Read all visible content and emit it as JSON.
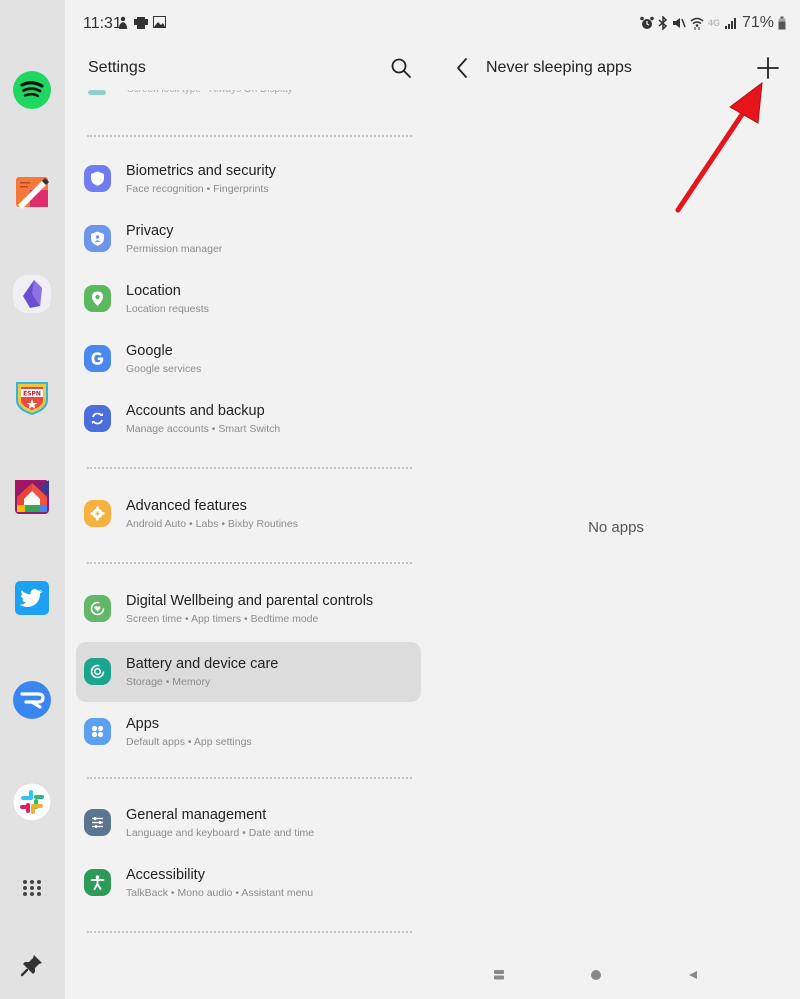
{
  "status_bar": {
    "time": "11:31",
    "notification_icons": [
      "accessibility-helper-icon",
      "phone-cast-icon",
      "gallery-icon"
    ],
    "system_icons": [
      "alarm-icon",
      "bluetooth-icon",
      "mute-icon",
      "wifi-icon",
      "4g-icon",
      "signal-icon"
    ],
    "network_label": "4G",
    "battery_percent": "71%"
  },
  "taskbar": {
    "apps": [
      {
        "name": "spotify",
        "color": "#1ed760"
      },
      {
        "name": "notes",
        "color": "#f26b3a"
      },
      {
        "name": "obsidian",
        "color": "#7c5fd6"
      },
      {
        "name": "espn-fantasy",
        "color": "#2aa0d8"
      },
      {
        "name": "google-home",
        "color": "#ea4335"
      },
      {
        "name": "twitter",
        "color": "#1da1f2"
      },
      {
        "name": "relay",
        "color": "#3d8bf2"
      },
      {
        "name": "slack",
        "color": "#ffffff"
      }
    ],
    "all_apps_icon": "grid-icon",
    "pin_icon": "pin-icon"
  },
  "settings": {
    "title": "Settings",
    "partial_item_subtitle": "Screen lock type  •  Always On Display",
    "groups": [
      {
        "items": [
          {
            "label": "Biometrics and security",
            "subtitle": "Face recognition  •  Fingerprints",
            "icon": "shield-icon",
            "color": "#6f7df0"
          },
          {
            "label": "Privacy",
            "subtitle": "Permission manager",
            "icon": "privacy-shield-icon",
            "color": "#6d95ec"
          },
          {
            "label": "Location",
            "subtitle": "Location requests",
            "icon": "location-pin-icon",
            "color": "#5cb85c"
          },
          {
            "label": "Google",
            "subtitle": "Google services",
            "icon": "google-icon",
            "color": "#4a87ee"
          },
          {
            "label": "Accounts and backup",
            "subtitle": "Manage accounts  •  Smart Switch",
            "icon": "sync-icon",
            "color": "#4a6fdc"
          }
        ]
      },
      {
        "items": [
          {
            "label": "Advanced features",
            "subtitle": "Android Auto  •  Labs  •  Bixby Routines",
            "icon": "gear-plus-icon",
            "color": "#f6b13f"
          }
        ]
      },
      {
        "items": [
          {
            "label": "Digital Wellbeing and parental controls",
            "subtitle": "Screen time  •  App timers  •  Bedtime mode",
            "icon": "wellbeing-icon",
            "color": "#62b768"
          },
          {
            "label": "Battery and device care",
            "subtitle": "Storage  •  Memory",
            "icon": "device-care-icon",
            "color": "#1aa58f",
            "active": true
          },
          {
            "label": "Apps",
            "subtitle": "Default apps  •  App settings",
            "icon": "apps-grid-icon",
            "color": "#5d9ff0"
          }
        ]
      },
      {
        "items": [
          {
            "label": "General management",
            "subtitle": "Language and keyboard  •  Date and time",
            "icon": "sliders-icon",
            "color": "#5b7591"
          },
          {
            "label": "Accessibility",
            "subtitle": "TalkBack  •  Mono audio  •  Assistant menu",
            "icon": "accessibility-icon",
            "color": "#2e9a58"
          }
        ]
      }
    ]
  },
  "detail": {
    "title": "Never sleeping apps",
    "empty_message": "No apps",
    "annotation_color": "#e8141b"
  },
  "navigation_bar": [
    "recents-icon",
    "home-icon",
    "back-icon"
  ]
}
